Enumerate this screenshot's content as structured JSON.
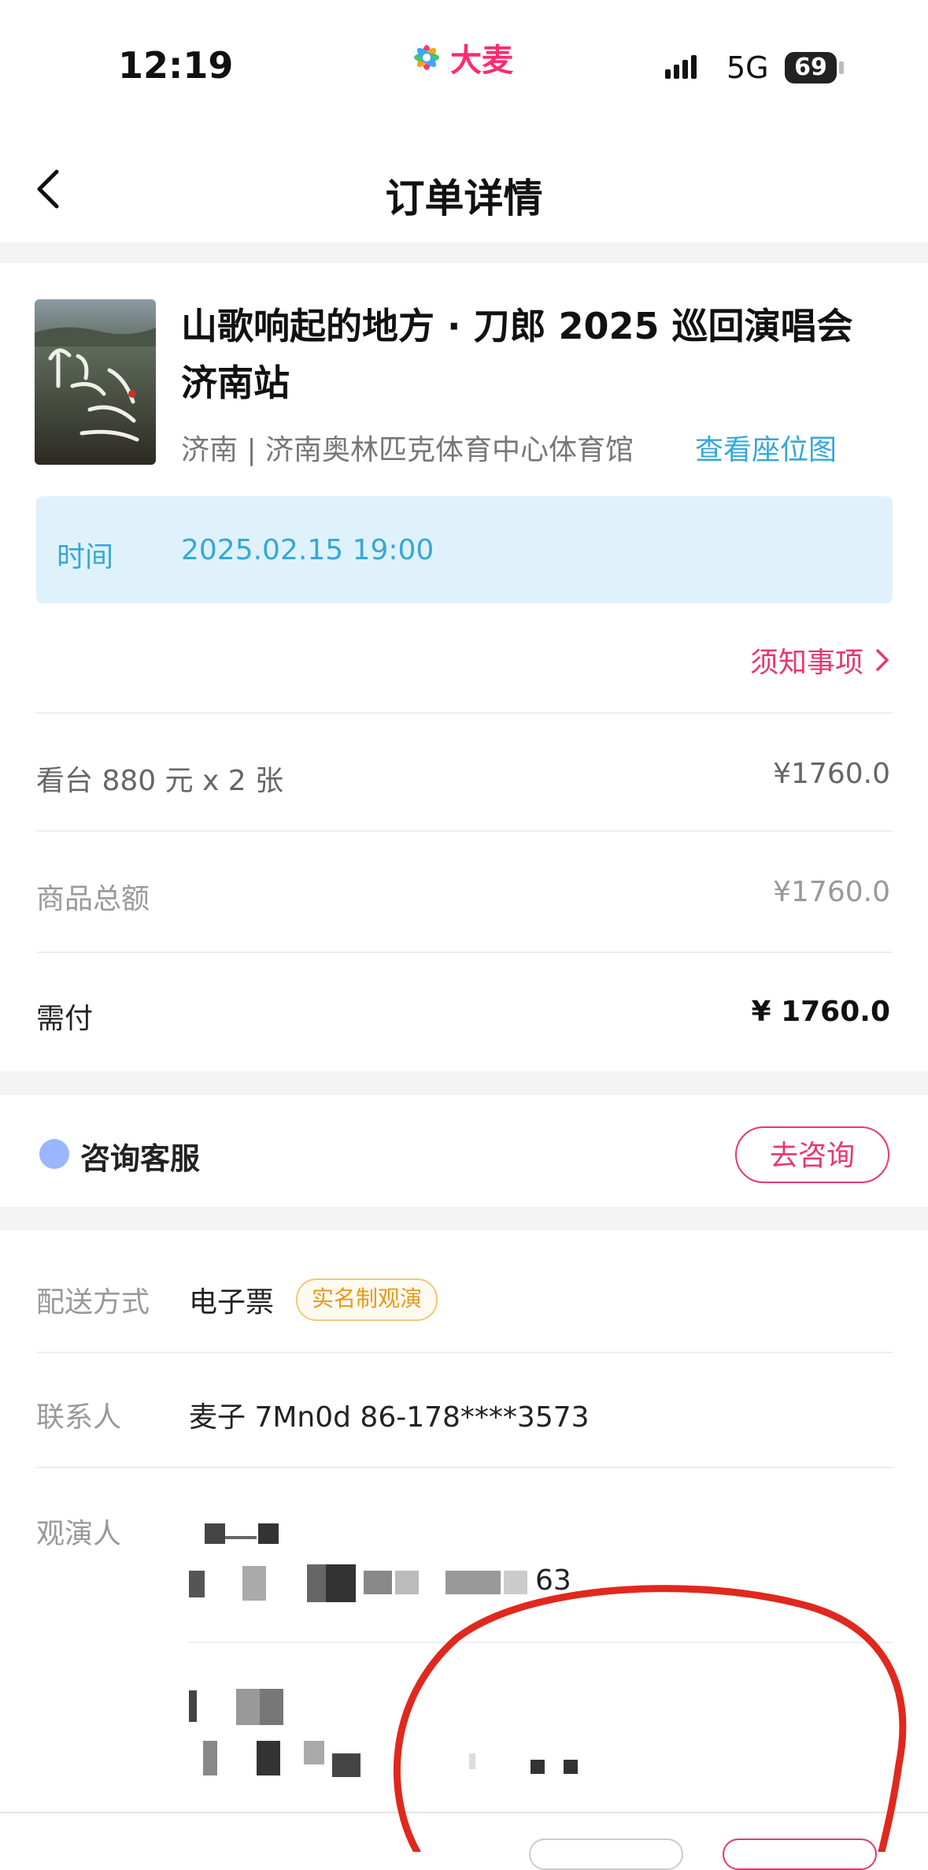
{
  "status_bar": {
    "time": "12:19",
    "brand": "大麦",
    "network": "5G",
    "battery": "69"
  },
  "nav": {
    "title": "订单详情"
  },
  "event": {
    "title": "山歌响起的地方 · 刀郎 2025 巡回演唱会 济南站",
    "venue": "济南 | 济南奥林匹克体育中心体育馆",
    "seat_map_link": "查看座位图",
    "time_label": "时间",
    "time_value": "2025.02.15 19:00",
    "notice_link": "须知事项"
  },
  "pricing": {
    "ticket_label": "看台 880 元 x 2 张",
    "ticket_amount": "¥1760.0",
    "subtotal_label": "商品总额",
    "subtotal_amount": "¥1760.0",
    "due_label": "需付",
    "due_amount": "¥ 1760.0"
  },
  "consult": {
    "label": "咨询客服",
    "button": "去咨询"
  },
  "delivery": {
    "method_label": "配送方式",
    "method_value": "电子票",
    "method_tag": "实名制观演",
    "contact_label": "联系人",
    "contact_value": "麦子 7Mn0d  86-178****3573",
    "attendee_label": "观演人",
    "attendee_id_tail": "63"
  },
  "colors": {
    "accent_pink": "#e8386d",
    "link_blue": "#36a7d8",
    "time_box_bg": "#dff2fb",
    "annotation_red": "#e0281e"
  }
}
